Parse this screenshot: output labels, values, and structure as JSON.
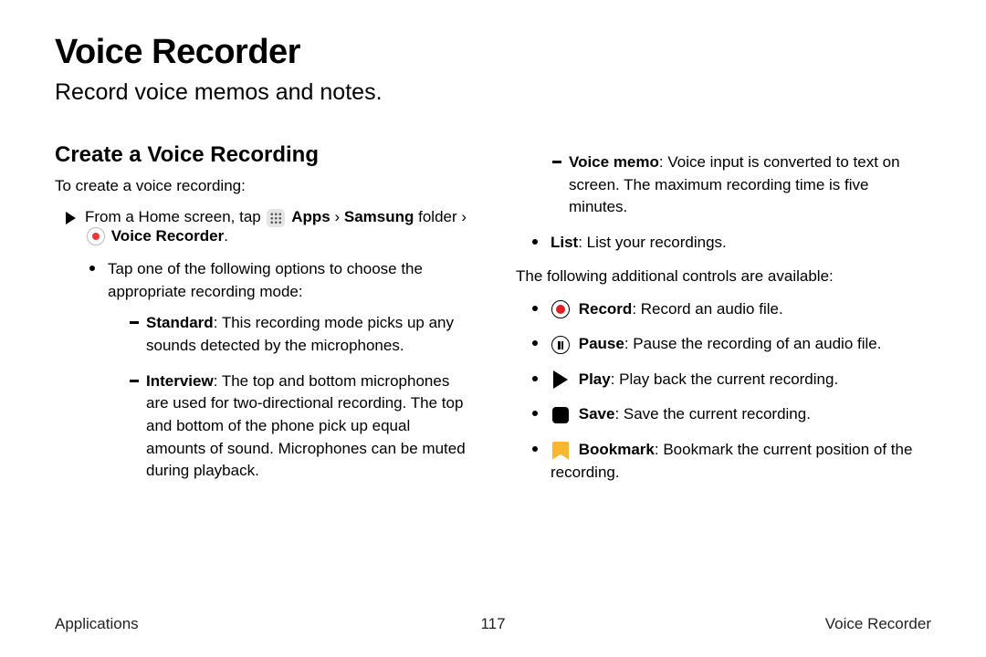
{
  "title": "Voice Recorder",
  "subtitle": "Record voice memos and notes.",
  "section_heading": "Create a Voice Recording",
  "intro": "To create a voice recording:",
  "step": {
    "prefix": "From a Home screen, tap",
    "apps": "Apps",
    "sep1": "›",
    "samsung_folder": "Samsung",
    "folder_word": "folder",
    "sep2": "›",
    "voice_recorder": "Voice Recorder",
    "period": "."
  },
  "mode_intro": "Tap one of the following options to choose the appropriate recording mode:",
  "modes": {
    "standard": {
      "label": "Standard",
      "desc": ": This recording mode picks up any sounds detected by the microphones."
    },
    "interview": {
      "label": "Interview",
      "desc": ": The top and bottom microphones are used for two-directional recording. The top and bottom of the phone pick up equal amounts of sound. Microphones can be muted during playback."
    },
    "voicememo": {
      "label": "Voice memo",
      "desc": ": Voice input is converted to text on screen. The maximum recording time is five minutes."
    }
  },
  "list_item": {
    "label": "List",
    "desc": ": List your recordings."
  },
  "controls_intro": "The following additional controls are available:",
  "controls": {
    "record": {
      "label": "Record",
      "desc": ": Record an audio file."
    },
    "pause": {
      "label": "Pause",
      "desc": ": Pause the recording of an audio file."
    },
    "play": {
      "label": "Play",
      "desc": ": Play back the current recording."
    },
    "save": {
      "label": "Save",
      "desc": ": Save the current recording."
    },
    "bookmark": {
      "label": "Bookmark",
      "desc": ": Bookmark the current position of the recording."
    }
  },
  "footer": {
    "left": "Applications",
    "center": "117",
    "right": "Voice Recorder"
  }
}
